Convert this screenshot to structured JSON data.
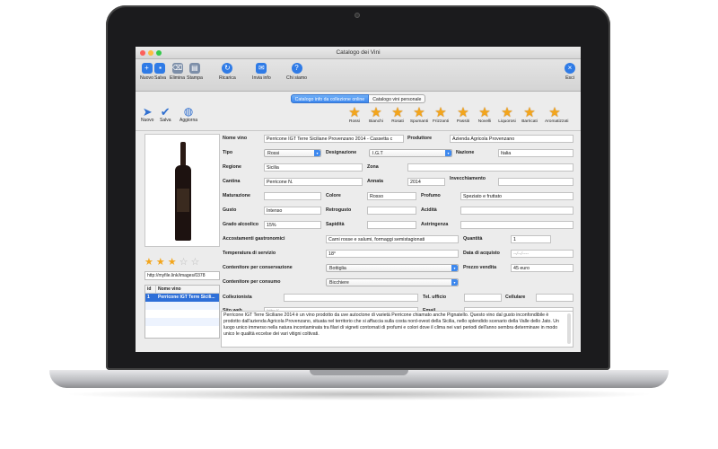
{
  "window": {
    "title": "Catalogo dei Vini"
  },
  "toolbar": {
    "nuovo": "Nuovo",
    "salva": "Salva",
    "elimina": "Elimina",
    "stampa": "Stampa",
    "ricarica": "Ricarica",
    "invia": "Invia info",
    "chi": "Chi siamo",
    "esci": "Esci"
  },
  "tabs": {
    "online": "Catalogo info da collezione online",
    "personale": "Catalogo vini personale"
  },
  "bar2": {
    "nuovo": "Nuovo",
    "salva": "Salva",
    "aggiorna": "Aggiorna",
    "cats": [
      "Rossi",
      "Bianchi",
      "Rosati",
      "Spumanti",
      "Frizzanti",
      "Passiti",
      "Novelli",
      "Liquorosi",
      "Barricati",
      "Aromatizzati"
    ]
  },
  "left": {
    "url": "http://myfile.link/images/0378",
    "col_id": "id",
    "col_name": "Nome vino",
    "rows": [
      {
        "id": "1",
        "name": "Perricone IGT Terre Sicili..."
      }
    ],
    "rating": 3
  },
  "form": {
    "nome_vino_l": "Nome vino",
    "nome_vino": "Perricone IGT Terre Siciliane Provenzano 2014 - Cassetta c",
    "produttore_l": "Produttore",
    "produttore": "Azienda Agricola Provenzano",
    "tipo_l": "Tipo",
    "tipo": "Rossi",
    "designazione_l": "Designazione",
    "designazione": "I.G.T",
    "nazione_l": "Nazione",
    "nazione": "Italia",
    "regione_l": "Regione",
    "regione": "Sicilia",
    "zona_l": "Zona",
    "zona": "",
    "cantina_l": "Cantina",
    "cantina": "Perricone N.",
    "annata_l": "Annata",
    "annata": "2014",
    "invecchiamento_l": "Invecchiamento",
    "invecchiamento": "",
    "maturazione_l": "Maturazione",
    "colore_l": "Colore",
    "colore": "Rosso",
    "profumo_l": "Profumo",
    "profumo": "Speziato e fruttato",
    "gusto_l": "Gusto",
    "gusto": "Intenso",
    "retrogusto_l": "Retrogusto",
    "acidita_l": "Acidità",
    "grado_l": "Grado alcoolico",
    "grado": "15%",
    "sapidita_l": "Sapidità",
    "astringenza_l": "Astringenza",
    "accostamenti_l": "Accostamenti gastronomici",
    "accostamenti": "Carni rosse e salumi, formaggi semistagionati",
    "quantita_l": "Quantità",
    "quantita": "1",
    "temperatura_l": "Temperatura di servizio",
    "temperatura": "18°",
    "data_l": "Data di acquisto",
    "data_ph": "--/--/----",
    "contconserv_l": "Contenitore per conservazione",
    "contconserv": "Bottiglia",
    "prezzo_l": "Prezzo vendita",
    "prezzo": "45 euro",
    "contconsumo_l": "Contenitore per consumo",
    "contconsumo": "Bicchiere",
    "collezionista_l": "Collezionista",
    "tel_l": "Tel. ufficio",
    "cell_l": "Cellulare",
    "sito_l": "Sito web",
    "sito_ph": "http://",
    "email_l": "Email"
  },
  "description": "Perricone IGT Terre Siciliane 2014 è un vino prodotto da uve autoctone di varietà Perricone chiamato anche Pignatello. Questo vino dal gusto inconfondibile è prodotto dall'azienda Agricola Provenzano, situata nel territorio che si affaccia sulla costa nord-ovest della Sicilia, nello splendido scenario della Valle dello Jato. Un luogo unico immerso nella natura incontaminata tra filari di vigneti contornati di profumi e colori dove il clima nei vari periodi dell'anno sembra determinare in modo unico le qualità eccelse dei vari vitigni coltivati.",
  "colors": {
    "accent": "#3d88ee",
    "star": "#f3a51b",
    "selected_row": "#2e6fd8"
  }
}
